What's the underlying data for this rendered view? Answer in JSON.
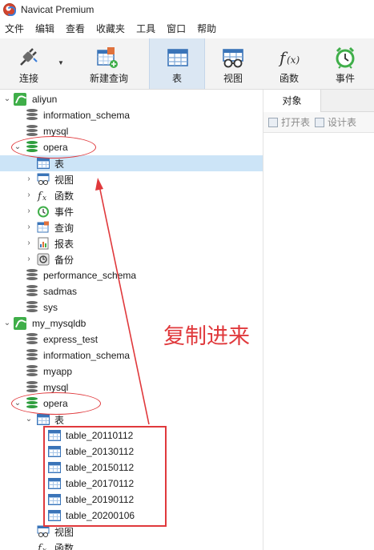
{
  "window": {
    "title": "Navicat Premium"
  },
  "menu": [
    "文件",
    "编辑",
    "查看",
    "收藏夹",
    "工具",
    "窗口",
    "帮助"
  ],
  "toolbar": {
    "connect": "连接",
    "new_query": "新建查询",
    "table": "表",
    "view": "视图",
    "function": "函数",
    "event": "事件"
  },
  "tree": {
    "conn1": "aliyun",
    "conn1_dbs": [
      "information_schema",
      "mysql"
    ],
    "opera1": "opera",
    "opera1_children": [
      "表",
      "视图",
      "函数",
      "事件",
      "查询",
      "报表",
      "备份"
    ],
    "conn1_dbs_after": [
      "performance_schema",
      "sadmas",
      "sys"
    ],
    "conn2": "my_mysqldb",
    "conn2_dbs": [
      "express_test",
      "information_schema",
      "myapp",
      "mysql"
    ],
    "opera2": "opera",
    "opera2_table": "表",
    "tables": [
      "table_20110112",
      "table_20130112",
      "table_20150112",
      "table_20170112",
      "table_20190112",
      "table_20200106"
    ],
    "opera2_after": [
      "视图",
      "函数"
    ]
  },
  "right_panel": {
    "tab": "对象",
    "open_table": "打开表",
    "design_table": "设计表"
  },
  "annotation": {
    "text": "复制进来",
    "color": "#e0393c"
  },
  "colors": {
    "selected_row": "#cce4f7",
    "toolbar_active": "#dbe7f3",
    "db_open": "#2e9e3e"
  }
}
